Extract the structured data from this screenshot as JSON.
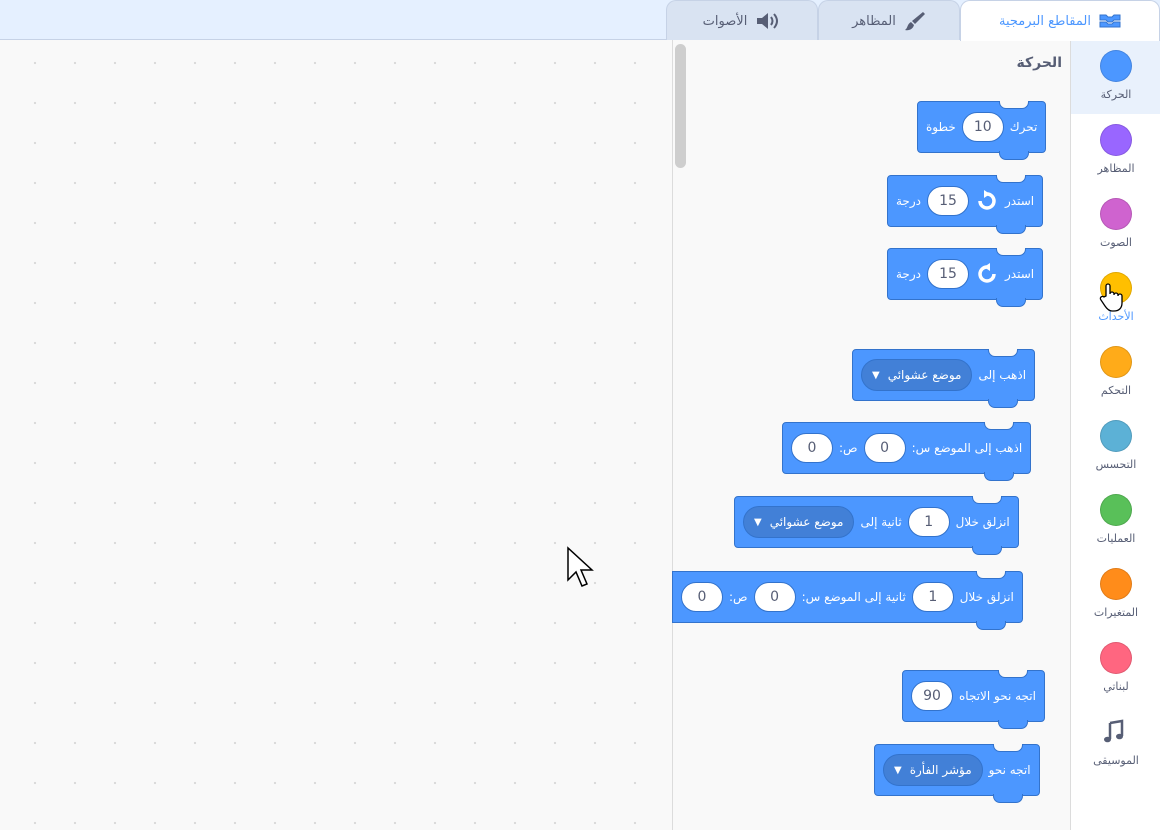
{
  "tabs": [
    {
      "label": "المقاطع البرمجية",
      "icon": "code-blocks-icon",
      "active": true
    },
    {
      "label": "المظاهر",
      "icon": "paintbrush-icon",
      "active": false
    },
    {
      "label": "الأصوات",
      "icon": "speaker-icon",
      "active": false
    }
  ],
  "palette": {
    "section_title": "الحركة",
    "blocks": [
      {
        "text_a": "تحرك",
        "value": "10",
        "text_b": "خطوة"
      },
      {
        "text_a": "استدر",
        "value": "15",
        "text_b": "درجة",
        "icon": "rotate-clockwise-icon"
      },
      {
        "text_a": "استدر",
        "value": "15",
        "text_b": "درجة",
        "icon": "rotate-counterclockwise-icon"
      },
      {
        "text_a": "اذهب إلى",
        "dropdown": "موضع عشوائي"
      },
      {
        "text_a": "اذهب إلى الموضع س:",
        "x": "0",
        "text_b": "ص:",
        "y": "0"
      },
      {
        "text_a": "انزلق خلال",
        "secs": "1",
        "text_b": "ثانية إلى",
        "dropdown": "موضع عشوائي"
      },
      {
        "text_a": "انزلق خلال",
        "secs": "1",
        "text_b": "ثانية إلى الموضع س:",
        "x": "0",
        "text_c": "ص:",
        "y": "0"
      },
      {
        "text_a": "اتجه نحو الاتجاه",
        "value": "90"
      },
      {
        "text_a": "اتجه نحو",
        "dropdown": "مؤشر الفأرة"
      }
    ]
  },
  "categories": [
    {
      "label": "الحركة",
      "color": "#4c97ff"
    },
    {
      "label": "المظاهر",
      "color": "#9966ff"
    },
    {
      "label": "الصوت",
      "color": "#cf63cf"
    },
    {
      "label": "الأحداث",
      "color": "#ffbf00"
    },
    {
      "label": "التحكم",
      "color": "#ffab19"
    },
    {
      "label": "التحسس",
      "color": "#5cb1d6"
    },
    {
      "label": "العمليات",
      "color": "#59c059"
    },
    {
      "label": "المتغيرات",
      "color": "#ff8c1a"
    },
    {
      "label": "لبناتي",
      "color": "#ff6680"
    },
    {
      "label": "الموسيقى",
      "icon": "music-notes-icon"
    }
  ],
  "colors": {
    "motion_block": "#4c97ff",
    "motion_border": "#3373cc",
    "accent": "#4c97ff"
  }
}
